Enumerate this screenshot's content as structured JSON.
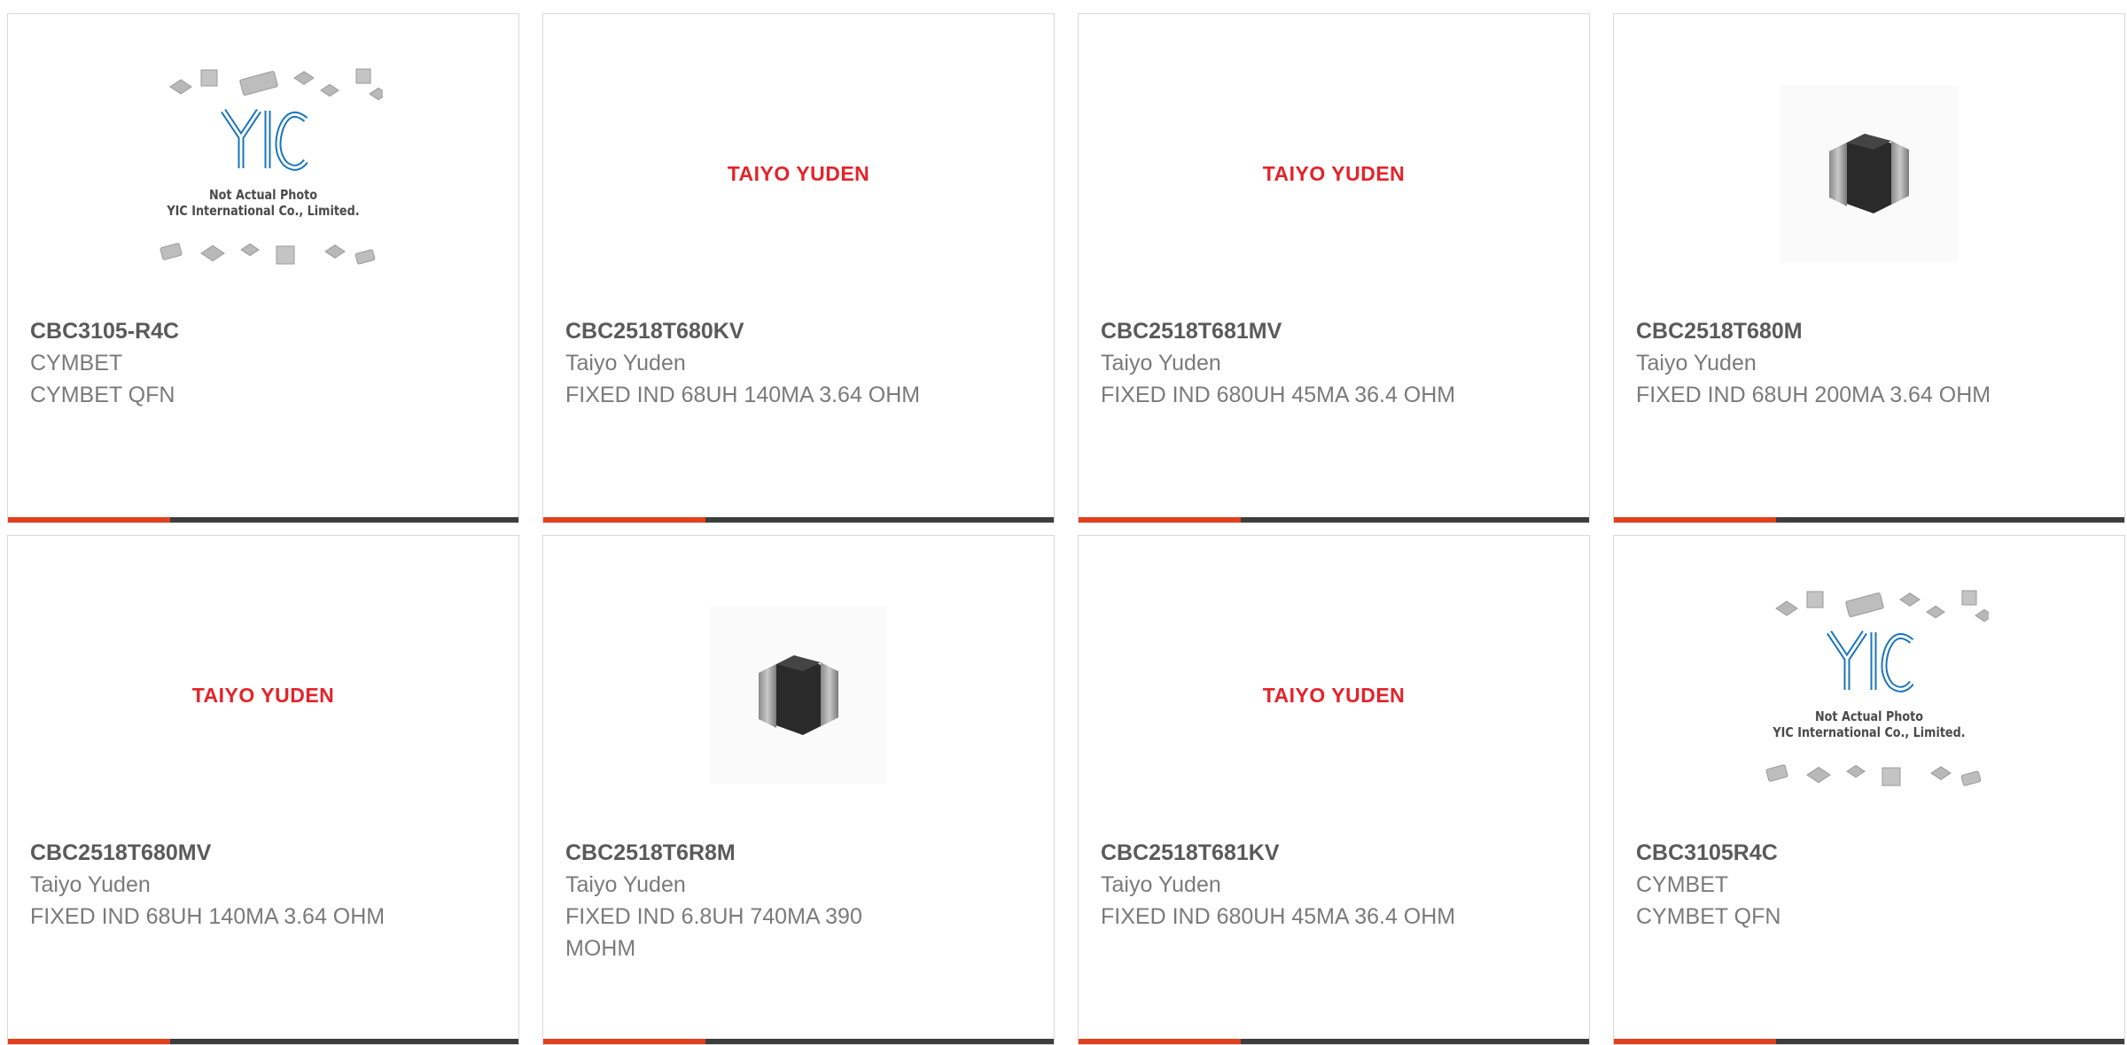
{
  "products": [
    {
      "part": "CBC3105-R4C",
      "manufacturer": "CYMBET",
      "description": "CYMBET QFN",
      "image": "placeholder",
      "placeholder_lines": [
        "Not Actual Photo",
        "YIC International Co., Limited."
      ],
      "logo_text": "YIC"
    },
    {
      "part": "CBC2518T680KV",
      "manufacturer": "Taiyo Yuden",
      "description": "FIXED IND 68UH 140MA 3.64 OHM",
      "image": "taiyo",
      "logo_text": "TAIYO YUDEN"
    },
    {
      "part": "CBC2518T681MV",
      "manufacturer": "Taiyo Yuden",
      "description": "FIXED IND 680UH 45MA 36.4 OHM",
      "image": "taiyo",
      "logo_text": "TAIYO YUDEN"
    },
    {
      "part": "CBC2518T680M",
      "manufacturer": "Taiyo Yuden",
      "description": "FIXED IND 68UH 200MA 3.64 OHM",
      "image": "photo"
    },
    {
      "part": "CBC2518T680MV",
      "manufacturer": "Taiyo Yuden",
      "description": "FIXED IND 68UH 140MA 3.64 OHM",
      "image": "taiyo",
      "logo_text": "TAIYO YUDEN"
    },
    {
      "part": "CBC2518T6R8M",
      "manufacturer": "Taiyo Yuden",
      "description": "FIXED IND 6.8UH 740MA 390 MOHM",
      "image": "photo"
    },
    {
      "part": "CBC2518T681KV",
      "manufacturer": "Taiyo Yuden",
      "description": "FIXED IND 680UH 45MA 36.4 OHM",
      "image": "taiyo",
      "logo_text": "TAIYO YUDEN"
    },
    {
      "part": "CBC3105R4C",
      "manufacturer": "CYMBET",
      "description": "CYMBET QFN",
      "image": "placeholder",
      "placeholder_lines": [
        "Not Actual Photo",
        "YIC International Co., Limited."
      ],
      "logo_text": "YIC"
    }
  ],
  "colors": {
    "accent": "#e1401e",
    "bar": "#3d3d3d",
    "logo_red": "#e4232a",
    "logo_blue": "#1b75bc"
  }
}
